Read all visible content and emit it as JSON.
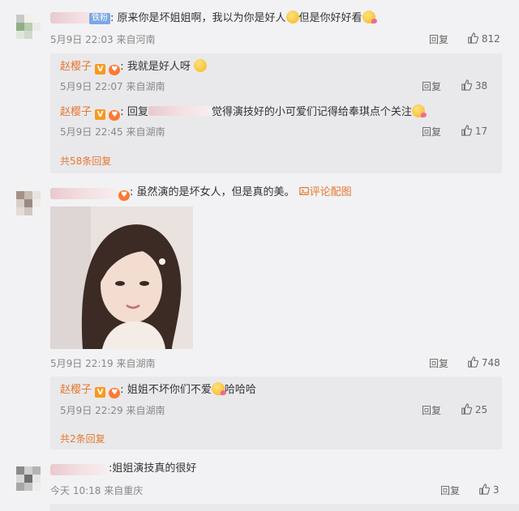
{
  "comments": [
    {
      "fan_badge": "铁粉",
      "text_a": "原来你是坏姐姐啊，我以为你是好人",
      "text_b": "但是你好好看",
      "time": "5月9日 22:03",
      "location": "来自河南",
      "reply_label": "回复",
      "likes": "812",
      "replies": [
        {
          "user": "赵樱子",
          "text": "我就是好人呀",
          "time": "5月9日 22:07",
          "location": "来自湖南",
          "reply_label": "回复",
          "likes": "38"
        },
        {
          "user": "赵樱子",
          "text_a": "回复",
          "text_b": "觉得演技好的小可爱们记得给奉琪点个关注",
          "time": "5月9日 22:45",
          "location": "来自湖南",
          "reply_label": "回复",
          "likes": "17"
        }
      ],
      "more_replies": "共58条回复"
    },
    {
      "text": "虽然演的是坏女人，但是真的美。",
      "pic_link": "评论配图",
      "time": "5月9日 22:19",
      "location": "来自湖南",
      "reply_label": "回复",
      "likes": "748",
      "replies": [
        {
          "user": "赵樱子",
          "text_a": "姐姐不坏你们不爱",
          "text_b": "哈哈哈",
          "time": "5月9日 22:29",
          "location": "来自湖南",
          "reply_label": "回复",
          "likes": "25"
        }
      ],
      "more_replies": "共2条回复"
    },
    {
      "text": "姐姐演技真的很好",
      "time": "今天 10:18",
      "location": "来自重庆",
      "reply_label": "回复",
      "likes": "3"
    }
  ],
  "colors": {
    "accent": "#e8772e",
    "background": "#f2f2f4",
    "reply_bg": "#e9e9ec"
  },
  "icons": {
    "like": "thumbs-up-icon",
    "verified": "v-badge-icon"
  }
}
